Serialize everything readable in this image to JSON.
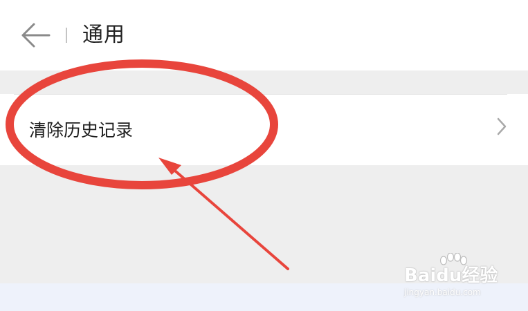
{
  "header": {
    "back_icon": "arrow-left-icon",
    "title": "通用"
  },
  "settings": {
    "items": [
      {
        "label": "清除历史记录",
        "icon": "chevron-right-icon"
      }
    ]
  },
  "annotation": {
    "shapes": [
      "red-ellipse",
      "red-arrow"
    ],
    "color": "#e8453c"
  },
  "watermark": {
    "logo": "Baidu经验",
    "url": "jingyan.baidu.com"
  },
  "colors": {
    "background": "#ffffff",
    "section_gap": "#eeeeee",
    "accent": "#e8453c",
    "text": "#222222"
  }
}
